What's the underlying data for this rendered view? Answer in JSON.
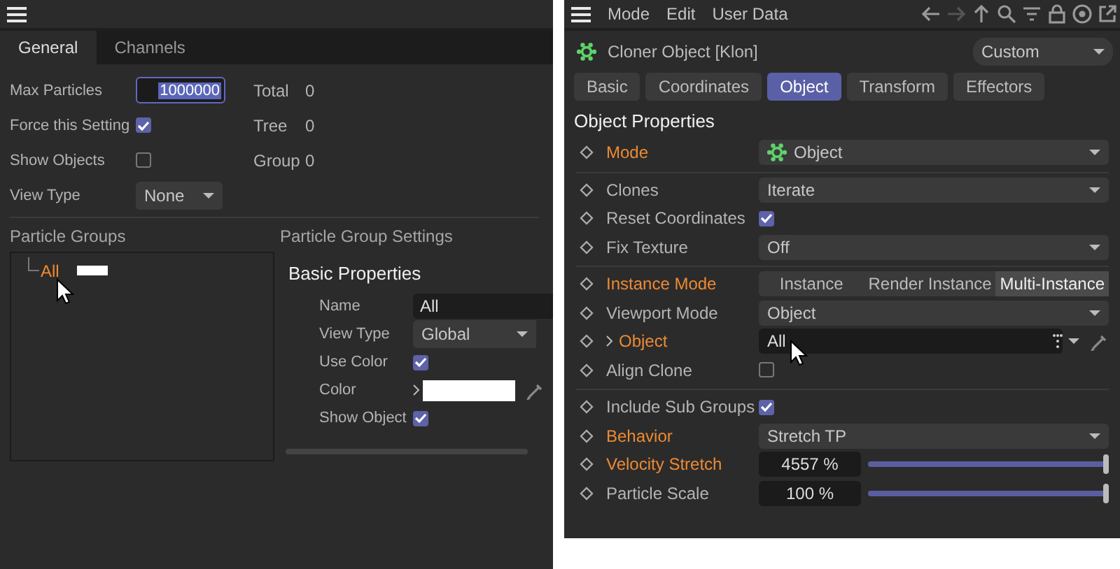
{
  "left_panel": {
    "tabs": [
      {
        "label": "General",
        "selected": true
      },
      {
        "label": "Channels",
        "selected": false
      }
    ],
    "settings": [
      {
        "label": "Max Particles",
        "kind": "field",
        "value": "1000000",
        "focused": true,
        "stat_label": "Total",
        "stat_value": "0"
      },
      {
        "label": "Force this Setting",
        "kind": "checkbox",
        "checked": true,
        "stat_label": "Tree",
        "stat_value": "0"
      },
      {
        "label": "Show Objects",
        "kind": "checkbox",
        "checked": false,
        "stat_label": "Group",
        "stat_value": "0"
      },
      {
        "label": "View Type",
        "kind": "dropdown",
        "value": "None"
      }
    ],
    "groups_title": "Particle Groups",
    "groups": [
      {
        "label": "All",
        "color": "#ffffff",
        "selected": true
      }
    ],
    "group_settings_title": "Particle Group Settings",
    "section_title": "Basic Properties",
    "properties": [
      {
        "label": "Name",
        "kind": "field",
        "value": "All"
      },
      {
        "label": "View Type",
        "kind": "dropdown",
        "value": "Global"
      },
      {
        "label": "Use Color",
        "kind": "checkbox",
        "checked": true
      },
      {
        "label": "Color",
        "kind": "color",
        "color": "#ffffff"
      },
      {
        "label": "Show Object",
        "kind": "checkbox",
        "checked": true
      }
    ]
  },
  "right_panel": {
    "menu": [
      "Mode",
      "Edit",
      "User Data"
    ],
    "object_title": "Cloner Object [Klon]",
    "preset": "Custom",
    "tabs": [
      {
        "label": "Basic",
        "selected": false
      },
      {
        "label": "Coordinates",
        "selected": false
      },
      {
        "label": "Object",
        "selected": true
      },
      {
        "label": "Transform",
        "selected": false
      },
      {
        "label": "Effectors",
        "selected": false
      }
    ],
    "section_title": "Object Properties",
    "groups": [
      {
        "rows": [
          {
            "label": "Mode",
            "kind": "dropdown",
            "value": "Object",
            "value_icon": true,
            "highlighted": true
          }
        ]
      },
      {
        "rows": [
          {
            "label": "Clones",
            "kind": "dropdown",
            "value": "Iterate",
            "highlighted": false
          },
          {
            "label": "Reset Coordinates",
            "kind": "checkbox",
            "checked": true,
            "highlighted": false
          },
          {
            "label": "Fix Texture",
            "kind": "dropdown",
            "value": "Off",
            "highlighted": false
          }
        ]
      },
      {
        "rows": [
          {
            "label": "Instance Mode",
            "kind": "segmented",
            "highlighted": true,
            "options": [
              {
                "label": "Instance",
                "selected": false
              },
              {
                "label": "Render Instance",
                "selected": false
              },
              {
                "label": "Multi-Instance",
                "selected": true
              }
            ]
          },
          {
            "label": "Viewport Mode",
            "kind": "dropdown",
            "value": "Object",
            "highlighted": false
          },
          {
            "label": "Object",
            "kind": "link",
            "value": "All",
            "expanded": false,
            "highlighted": true
          },
          {
            "label": "Align Clone",
            "kind": "checkbox",
            "checked": false,
            "highlighted": false
          }
        ]
      },
      {
        "rows": [
          {
            "label": "Include Sub Groups",
            "kind": "checkbox",
            "checked": true,
            "highlighted": false
          },
          {
            "label": "Behavior",
            "kind": "dropdown",
            "value": "Stretch TP",
            "highlighted": true
          },
          {
            "label": "Velocity Stretch",
            "kind": "slider",
            "value": "4557 %",
            "level": 1,
            "highlighted": true
          },
          {
            "label": "Particle Scale",
            "kind": "slider",
            "value": "100 %",
            "level": 1,
            "highlighted": false
          }
        ]
      }
    ]
  }
}
